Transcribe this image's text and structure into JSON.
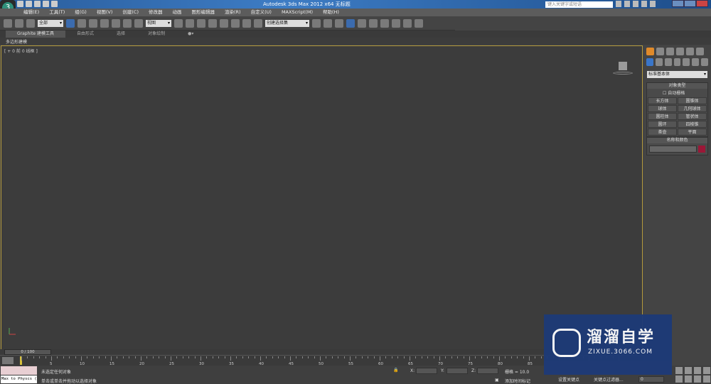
{
  "window": {
    "title": "Autodesk 3ds Max  2012 x64    无标题",
    "search_placeholder": "键入关键字或短语"
  },
  "menu": [
    "编辑(E)",
    "工具(T)",
    "组(G)",
    "视图(V)",
    "创建(C)",
    "修改器",
    "动画",
    "图形编辑器",
    "渲染(R)",
    "自定义(U)",
    "MAXScript(M)",
    "帮助(H)"
  ],
  "toolbar": {
    "selection_filter": "全部",
    "ref_coord": "视图",
    "named_selection": "创建选择集"
  },
  "ribbon": {
    "tabs": [
      "Graphite 建模工具",
      "自由形式",
      "选择",
      "对象绘制"
    ],
    "sub": "多边形建模"
  },
  "viewport": {
    "label": "[ + 0 前 0 线框 ]"
  },
  "command_panel": {
    "category": "标准基本体",
    "object_type_title": "对象类型",
    "autogrid": "自动栅格",
    "buttons": [
      "长方体",
      "圆锥体",
      "球体",
      "几何球体",
      "圆柱体",
      "管状体",
      "圆环",
      "四棱锥",
      "茶壶",
      "平面"
    ],
    "name_color_title": "名称和颜色",
    "color": "#9b1737"
  },
  "timeline": {
    "position": "0 / 100",
    "ticks": [
      "5",
      "10",
      "15",
      "20",
      "25",
      "30",
      "35",
      "40",
      "45",
      "50",
      "55",
      "60",
      "65",
      "70",
      "75",
      "80",
      "85"
    ]
  },
  "status": {
    "maxscript": "Max to Physcs (",
    "line1": "未选定任何对象",
    "line2": "单击或单击并拖动以选择对象",
    "x_label": "X:",
    "y_label": "Y:",
    "z_label": "Z:",
    "grid": "栅格 = 10.0",
    "add_tag": "添加时间标记",
    "set_key": "设置关键点",
    "key_filters": "关键点过滤器...",
    "frame": "0"
  },
  "watermark": {
    "text": "溜溜自学",
    "url": "ZIXUE.3066.COM"
  }
}
